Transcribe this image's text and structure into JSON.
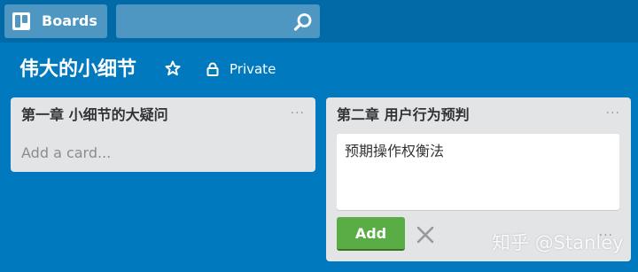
{
  "header": {
    "boards_label": "Boards",
    "boards_icon": "boards-icon",
    "search_icon": "search-icon"
  },
  "board": {
    "title": "伟大的小细节",
    "star_icon": "star-icon",
    "lock_icon": "lock-icon",
    "visibility": "Private"
  },
  "lists": [
    {
      "title": "第一章 小细节的大疑问",
      "menu": "···",
      "add_card_label": "Add a card..."
    },
    {
      "title": "第二章 用户行为预判",
      "menu": "···",
      "composer_text": "预期操作权衡法",
      "add_button_label": "Add",
      "close_icon": "close-icon",
      "composer_menu": "···"
    }
  ],
  "watermark": "知乎 @Stanley",
  "colors": {
    "board_bg": "#0079bf",
    "header_bg": "#026aa7",
    "header_btn": "#4d97c2",
    "list_bg": "#e2e4e6",
    "add_green": "#5aac44"
  }
}
